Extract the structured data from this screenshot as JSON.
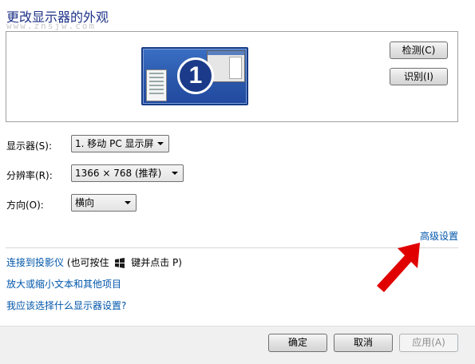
{
  "header": {
    "title": "更改显示器的外观",
    "watermark": "www.znsjw.com"
  },
  "preview": {
    "monitor_number": "1",
    "detect_label": "检测(C)",
    "identify_label": "识别(I)"
  },
  "settings": {
    "display_label": "显示器(S):",
    "display_value": "1. 移动 PC 显示屏",
    "resolution_label": "分辨率(R):",
    "resolution_value": "1366 × 768 (推荐)",
    "orientation_label": "方向(O):",
    "orientation_value": "横向"
  },
  "advanced_link": "高级设置",
  "links": {
    "projector": "连接到投影仪",
    "projector_note_pre": "(也可按住",
    "projector_note_post": "键并点击 P)",
    "enlarge_text": "放大或缩小文本和其他项目",
    "which_settings": "我应该选择什么显示器设置?"
  },
  "footer": {
    "ok_label": "确定",
    "cancel_label": "取消",
    "apply_label": "应用(A)"
  },
  "colors": {
    "title": "#1e3287",
    "link": "#0055aa",
    "annotation_arrow": "#e00000"
  }
}
